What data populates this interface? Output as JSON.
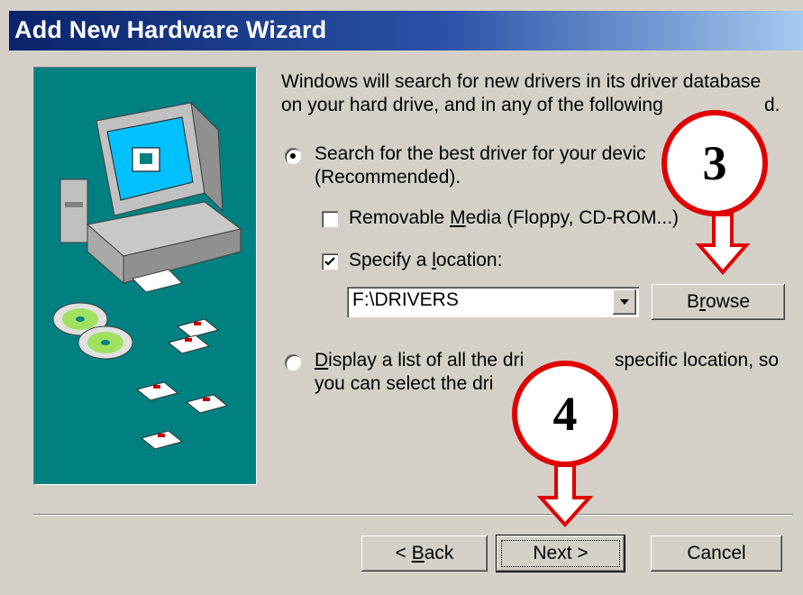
{
  "window": {
    "title": "Add New Hardware Wizard"
  },
  "intro_text": {
    "line1": "Windows will search for new drivers in its driver database",
    "line2": "on your hard drive, and in any of the following",
    "line2_tail": "d."
  },
  "options": {
    "search_best": {
      "label_line1": "Search for the best driver for your devic",
      "label_line2": "(Recommended).",
      "selected": true
    },
    "removable_media": {
      "label_prefix": "Removable ",
      "label_hotkey": "M",
      "label_suffix": "edia (Floppy, CD-ROM...)",
      "checked": false
    },
    "specify_location": {
      "label_prefix": "Specify a ",
      "label_hotkey": "l",
      "label_suffix": "ocation:",
      "checked": true
    },
    "location_value": "F:\\DRIVERS",
    "browse_label_prefix": "B",
    "browse_label_hotkey": "r",
    "browse_label_suffix": "owse",
    "display_list": {
      "label_hotkey": "D",
      "label_line1_a": "isplay a list of all the dri",
      "label_line1_b": "specific location, so",
      "label_line2": "you can select the dri",
      "selected": false
    }
  },
  "buttons": {
    "back_prefix": "< ",
    "back_hotkey": "B",
    "back_suffix": "ack",
    "next": "Next >",
    "cancel": "Cancel"
  },
  "callouts": {
    "step3": "3",
    "step4": "4"
  },
  "colors": {
    "title_bar": "#0a246a",
    "left_panel": "#008080",
    "dialog_face": "#d4d0c8",
    "callout_red": "#e00000"
  }
}
